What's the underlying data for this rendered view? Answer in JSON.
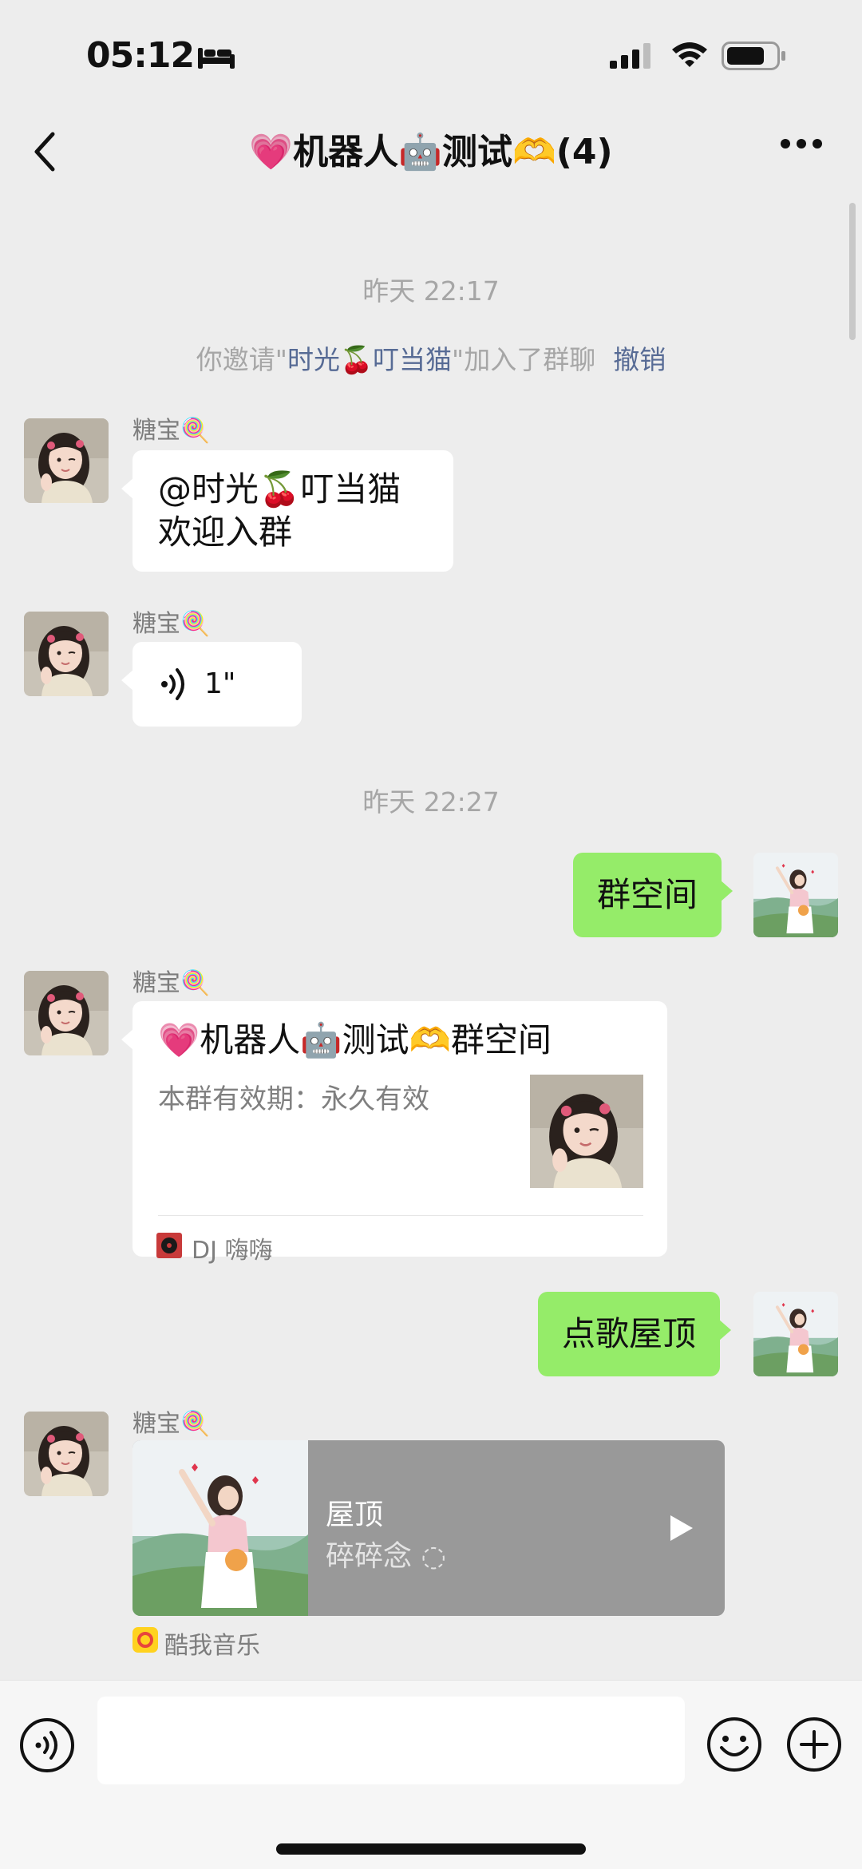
{
  "status_bar": {
    "time": "05:12"
  },
  "nav": {
    "title": "💗机器人🤖测试🫶(4)"
  },
  "chat": {
    "ts1": "昨天 22:17",
    "system": {
      "prefix": "你邀请\"",
      "name": "时光🍒叮当猫",
      "suffix": "\"加入了群聊",
      "undo": "撤销"
    },
    "msg1": {
      "sender": "糖宝🍭",
      "line1": "@时光🍒叮当猫",
      "line2": "欢迎入群"
    },
    "msg2": {
      "sender": "糖宝🍭",
      "duration": "1\""
    },
    "ts2": "昨天 22:27",
    "out1": {
      "text": "群空间"
    },
    "msg3": {
      "sender": "糖宝🍭",
      "card_title": "💗机器人🤖测试🫶群空间",
      "card_desc": "本群有效期：永久有效",
      "card_source": "DJ 嗨嗨"
    },
    "out2": {
      "text": "点歌屋顶"
    },
    "msg4": {
      "sender": "糖宝🍭",
      "song": "屋顶",
      "artist": "碎碎念",
      "source": "酷我音乐"
    }
  },
  "input": {
    "placeholder": ""
  },
  "colors": {
    "background": "#ededed",
    "outgoing_bubble": "#95ec69",
    "incoming_bubble": "#ffffff",
    "link": "#576b95",
    "music_card": "#999999"
  },
  "icons": [
    "bed-icon",
    "signal-icon",
    "wifi-icon",
    "battery-icon",
    "back-icon",
    "more-icon",
    "voice-icon",
    "play-icon",
    "voice-toggle-icon",
    "emoji-icon",
    "plus-icon"
  ]
}
